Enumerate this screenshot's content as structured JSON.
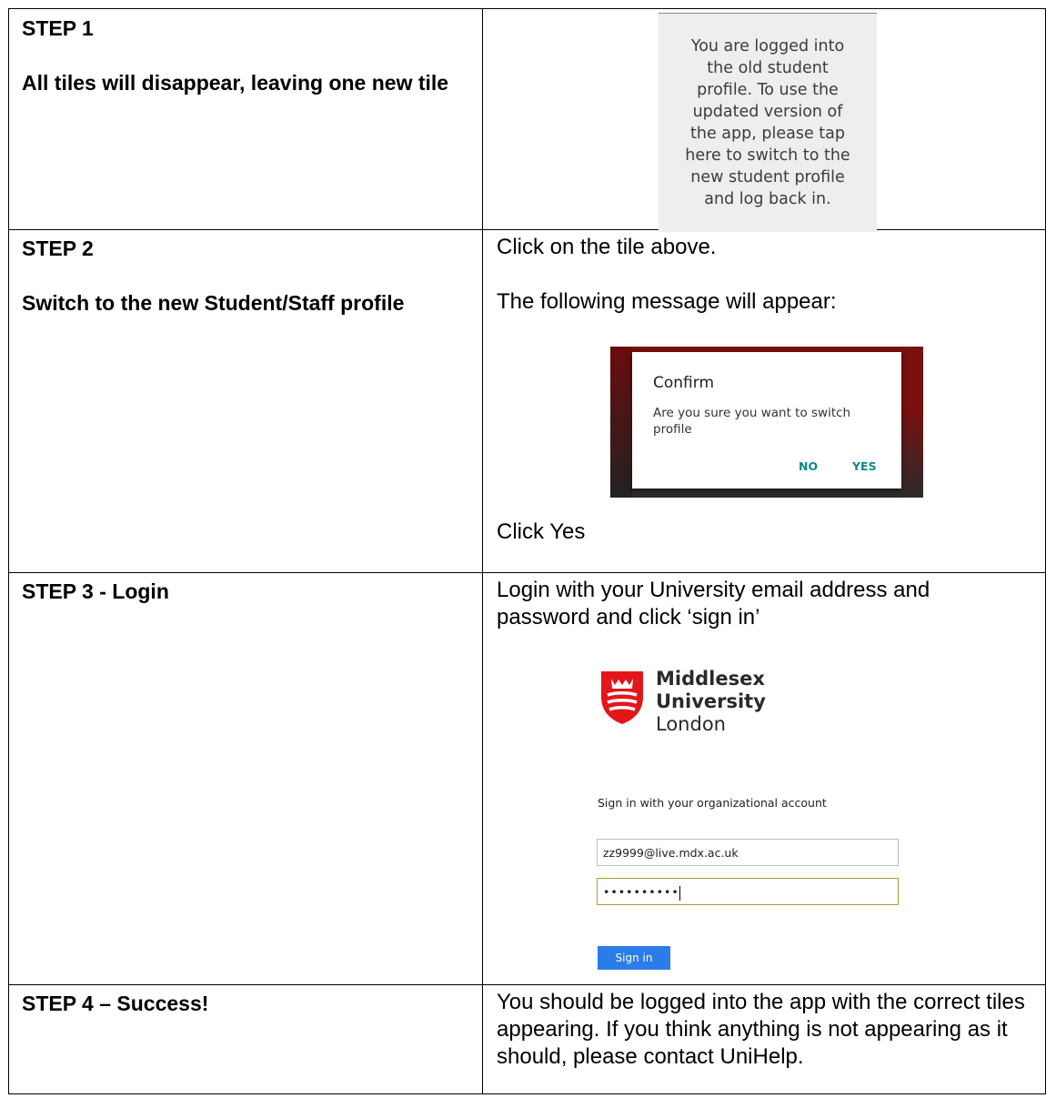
{
  "step1": {
    "heading": "STEP 1",
    "description": "All tiles will disappear, leaving one new tile",
    "tile_text": "You are logged into the old student profile. To use the updated version of the app, please tap here to switch to the new student profile and log back in."
  },
  "step2": {
    "heading": "STEP 2",
    "description": "Switch to the new Student/Staff profile",
    "instruction1": "Click on the tile above.",
    "instruction2": "The following message will appear:",
    "dialog": {
      "title": "Confirm",
      "message": "Are you sure you want to switch profile",
      "no_label": "NO",
      "yes_label": "YES",
      "button_color": "#0b8a8a"
    },
    "instruction3": "Click Yes"
  },
  "step3": {
    "heading": "STEP 3 - Login",
    "instruction": "Login with your University email address and password and click ‘sign in’",
    "logo": {
      "line1": "Middlesex",
      "line2": "University",
      "line3": "London",
      "shield_color": "#e2161b"
    },
    "signin_label": "Sign in with your organizational account",
    "email_value": "zz9999@live.mdx.ac.uk",
    "password_value": "••••••••••",
    "signin_button": "Sign in",
    "button_color": "#2a7ce8"
  },
  "step4": {
    "heading": "STEP 4 – Success!",
    "message": "You should be logged into the app with the correct tiles appearing. If you think anything is not appearing as it should, please contact UniHelp."
  }
}
